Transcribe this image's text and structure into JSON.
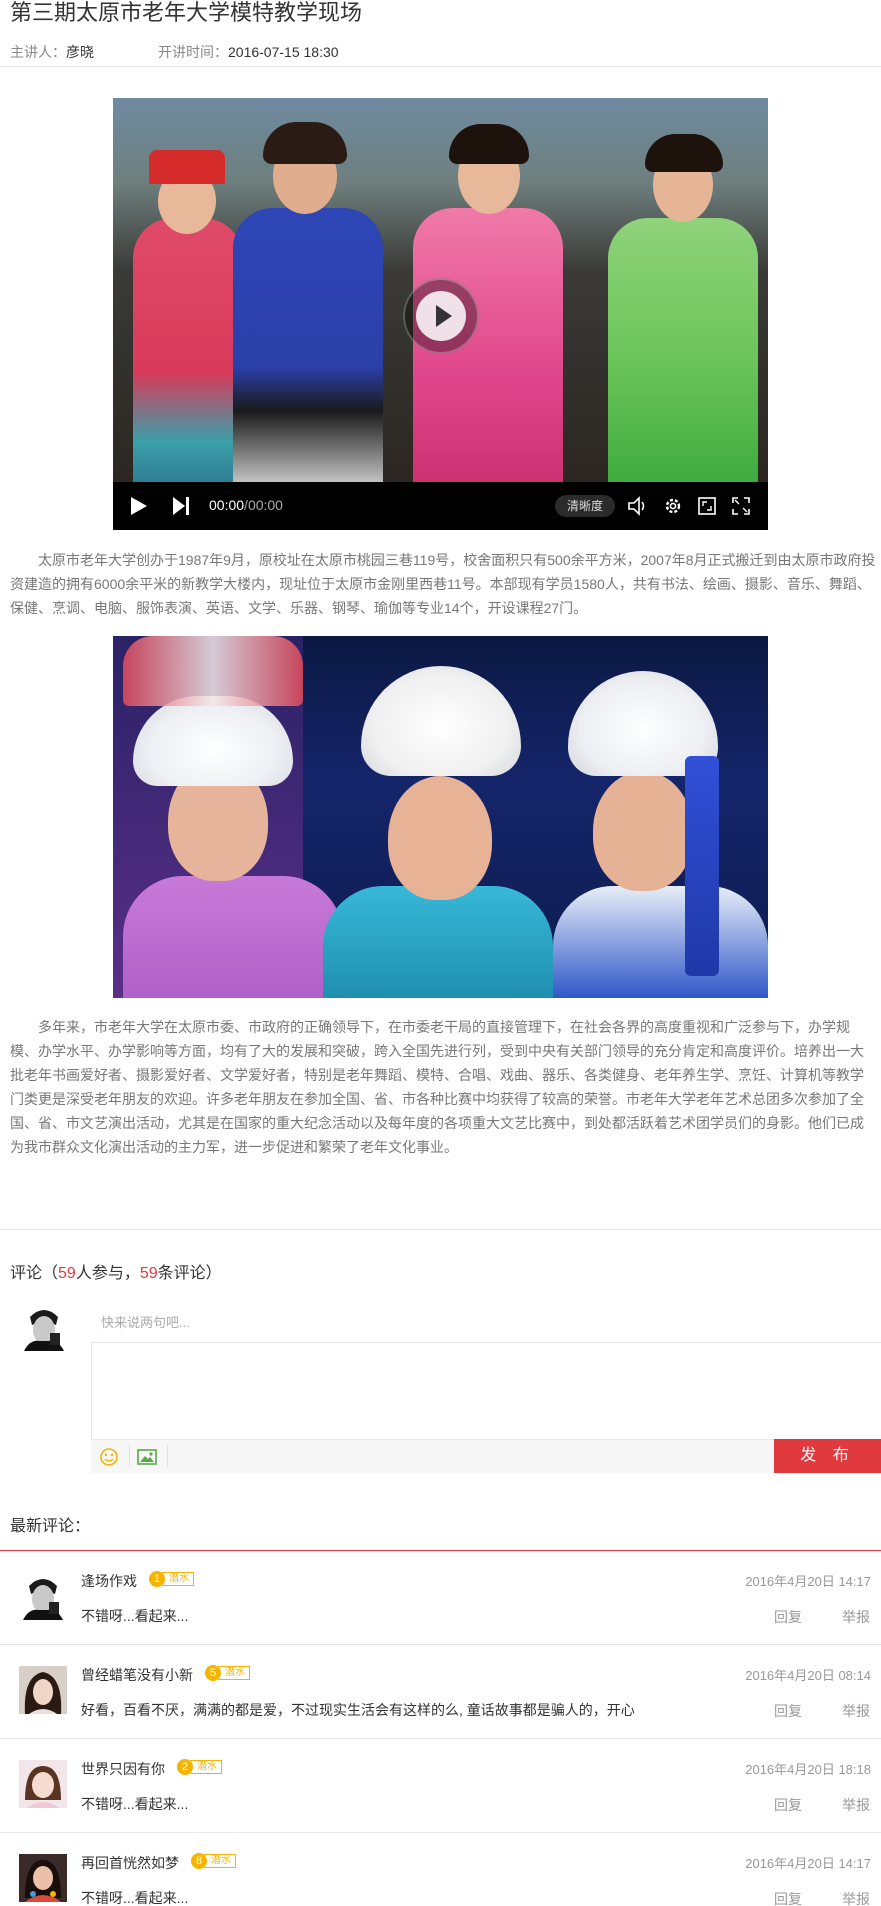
{
  "header": {
    "title": "第三期太原市老年大学模特教学现场",
    "speaker_label": "主讲人：",
    "speaker": "彦晓",
    "time_label": "开讲时间：",
    "time": "2016-07-15  18:30"
  },
  "video": {
    "current_time": "00:00",
    "separator": "/",
    "duration": "00:00",
    "quality_label": "清晰度",
    "icons": [
      "play-icon",
      "next-icon",
      "volume-icon",
      "settings-icon",
      "window-mode-icon",
      "fullscreen-icon"
    ]
  },
  "article": {
    "paragraph1": "太原市老年大学创办于1987年9月，原校址在太原市桃园三巷119号，校舍面积只有500余平方米，2007年8月正式搬迁到由太原市政府投资建造的拥有6000余平米的新教学大楼内，现址位于太原市金刚里西巷11号。本部现有学员1580人，共有书法、绘画、摄影、音乐、舞蹈、保健、烹调、电脑、服饰表演、英语、文学、乐器、钢琴、瑜伽等专业14个，开设课程27门。",
    "paragraph2": "多年来，市老年大学在太原市委、市政府的正确领导下，在市委老干局的直接管理下，在社会各界的高度重视和广泛参与下，办学规模、办学水平、办学影响等方面，均有了大的发展和突破，跨入全国先进行列，受到中央有关部门领导的充分肯定和高度评价。培养出一大批老年书画爱好者、摄影爱好者、文学爱好者，特别是老年舞蹈、模特、合唱、戏曲、器乐、各类健身、老年养生学、烹饪、计算机等教学门类更是深受老年朋友的欢迎。许多老年朋友在参加全国、省、市各种比赛中均获得了较高的荣誉。市老年大学老年艺术总团多次参加了全国、省、市文艺演出活动，尤其是在国家的重大纪念活动以及每年度的各项重大文艺比赛中，到处都活跃着艺术团学员们的身影。他们已成为我市群众文化演出活动的主力军，进一步促进和繁荣了老年文化事业。"
  },
  "comments_section": {
    "label_prefix": "评论（",
    "participants": "59",
    "participants_suffix": "人参与，",
    "count": "59",
    "count_suffix": "条评论）",
    "input_placeholder": "快来说两句吧...",
    "post_label": "发 布",
    "latest_label": "最新评论："
  },
  "comments": [
    {
      "name": "逢场作戏",
      "level": "1",
      "badge": "潜水",
      "date": "2016年4月20日 14:17",
      "text": "不错呀...看起来...",
      "reply": "回复",
      "report": "举报"
    },
    {
      "name": "曾经蜡笔没有小新",
      "level": "5",
      "badge": "潜水",
      "date": "2016年4月20日 08:14",
      "text": "好看，百看不厌，满满的都是爱，不过现实生活会有这样的么, 童话故事都是骗人的，开心",
      "reply": "回复",
      "report": "举报"
    },
    {
      "name": "世界只因有你",
      "level": "2",
      "badge": "潜水",
      "date": "2016年4月20日 18:18",
      "text": "不错呀...看起来...",
      "reply": "回复",
      "report": "举报"
    },
    {
      "name": "再回首恍然如梦",
      "level": "8",
      "badge": "潜水",
      "date": "2016年4月20日 14:17",
      "text": "不错呀...看起来...",
      "reply": "回复",
      "report": "举报"
    }
  ],
  "colors": {
    "accent": "#e03a3e",
    "badge": "#f5b400",
    "muted": "#999999"
  }
}
